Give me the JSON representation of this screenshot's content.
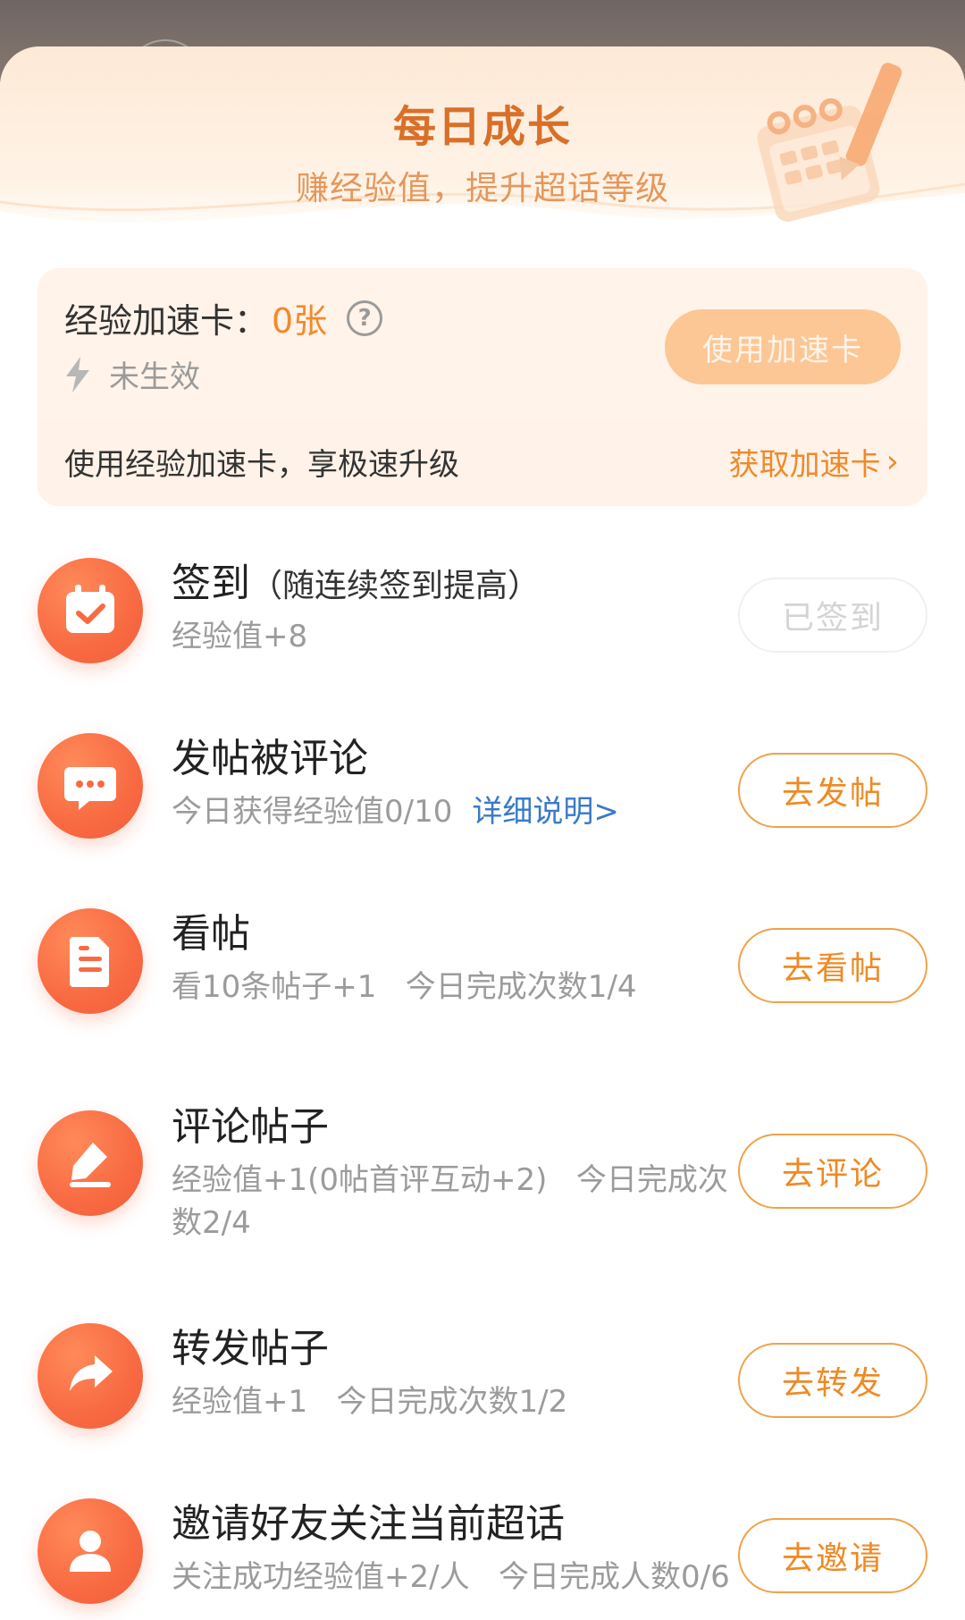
{
  "header": {
    "title": "每日成长",
    "subtitle": "赚经验值，提升超话等级"
  },
  "speed_card": {
    "label": "经验加速卡：",
    "count": "0张",
    "status": "未生效",
    "use_button": "使用加速卡",
    "tip": "使用经验加速卡，享极速升级",
    "get_link": "获取加速卡"
  },
  "tasks": [
    {
      "icon": "calendar-check-icon",
      "title": "签到",
      "note": "（随连续签到提高）",
      "desc": "经验值+8",
      "button": "已签到",
      "done": true
    },
    {
      "icon": "chat-bubble-icon",
      "title": "发帖被评论",
      "desc": "今日获得经验值0/10",
      "link": "详细说明>",
      "button": "去发帖"
    },
    {
      "icon": "document-icon",
      "title": "看帖",
      "desc": "看10条帖子+1   今日完成次数1/4",
      "button": "去看帖"
    },
    {
      "icon": "pencil-icon",
      "title": "评论帖子",
      "desc": "经验值+1(0帖首评互动+2)   今日完成次数2/4",
      "button": "去评论"
    },
    {
      "icon": "share-arrow-icon",
      "title": "转发帖子",
      "desc": "经验值+1   今日完成次数1/2",
      "button": "去转发"
    },
    {
      "icon": "person-icon",
      "title": "邀请好友关注当前超话",
      "desc": "关注成功经验值+2/人   今日完成人数0/6",
      "button": "去邀请"
    }
  ],
  "colors": {
    "accent": "#ee8a24",
    "icon_gradient": "#f86a42",
    "title": "#d8702a",
    "link_blue": "#3a7ac9"
  }
}
